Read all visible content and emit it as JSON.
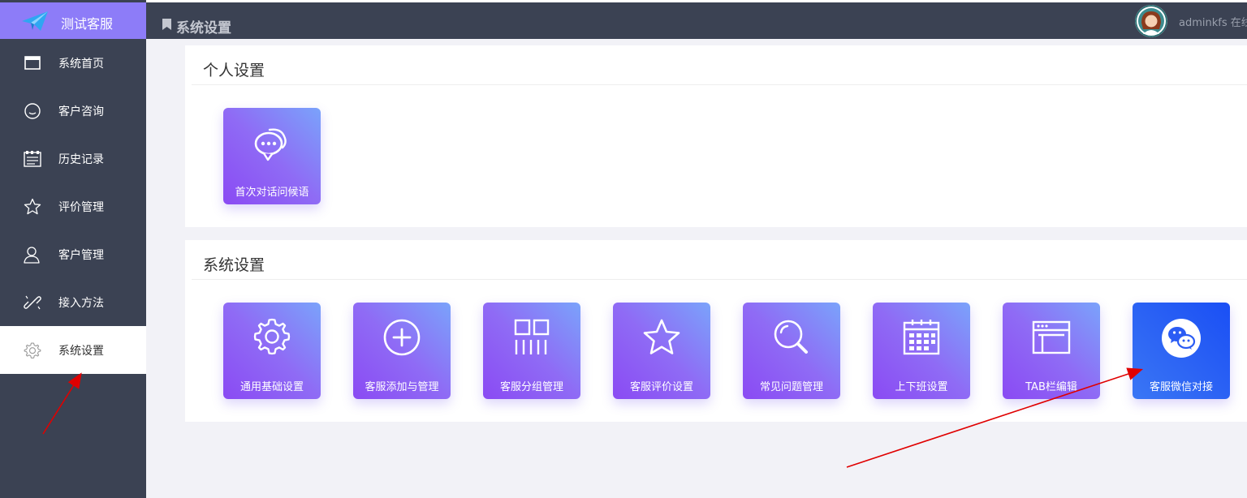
{
  "brand": {
    "name": "测试客服",
    "color": "#8d7cf8"
  },
  "sidebar": {
    "items": [
      {
        "label": "系统首页",
        "icon": "window-icon"
      },
      {
        "label": "客户咨询",
        "icon": "smile-icon"
      },
      {
        "label": "历史记录",
        "icon": "calendar-list-icon"
      },
      {
        "label": "评价管理",
        "icon": "star-icon"
      },
      {
        "label": "客户管理",
        "icon": "user-icon"
      },
      {
        "label": "接入方法",
        "icon": "link-icon"
      },
      {
        "label": "系统设置",
        "icon": "gear-icon",
        "active": true
      }
    ]
  },
  "topbar": {
    "title": "系统设置",
    "username": "adminkfs 在线"
  },
  "personal": {
    "title": "个人设置",
    "tiles": [
      {
        "label": "首次对话问候语",
        "icon": "chat-bubbles-icon"
      }
    ]
  },
  "system": {
    "title": "系统设置",
    "tiles": [
      {
        "label": "通用基础设置",
        "icon": "gear-icon"
      },
      {
        "label": "客服添加与管理",
        "icon": "plus-circle-icon"
      },
      {
        "label": "客服分组管理",
        "icon": "grid-group-icon"
      },
      {
        "label": "客服评价设置",
        "icon": "star-icon"
      },
      {
        "label": "常见问题管理",
        "icon": "search-icon"
      },
      {
        "label": "上下班设置",
        "icon": "calendar-icon"
      },
      {
        "label": "TAB栏编辑",
        "icon": "browser-window-icon"
      },
      {
        "label": "客服微信对接",
        "icon": "wechat-icon"
      }
    ]
  },
  "colors": {
    "sidebar_bg": "#3b4253",
    "tile_gradient": [
      "#8a4af3",
      "#7aa3fb"
    ],
    "wechat_tile": "#1a4ff5",
    "annotation_arrow": "#e00000"
  }
}
